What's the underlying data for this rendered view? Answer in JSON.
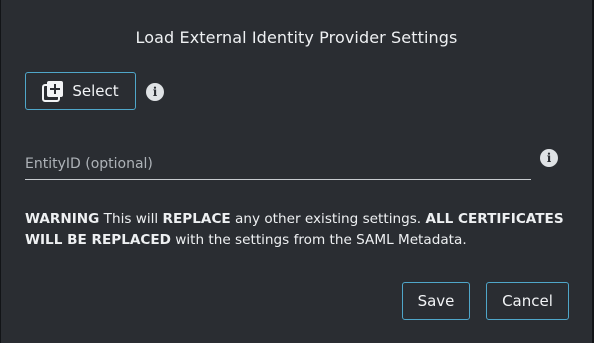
{
  "dialog": {
    "title": "Load External Identity Provider Settings",
    "select_label": "Select",
    "entity_placeholder": "EntityID (optional)",
    "entity_value": "",
    "warning": {
      "part1_bold": "WARNING",
      "part2": " This will ",
      "part3_bold": "REPLACE",
      "part4": " any other existing settings. ",
      "part5_bold": "ALL CERTIFICATES WILL BE REPLACED",
      "part6": " with the settings from the SAML Metadata."
    },
    "save_label": "Save",
    "cancel_label": "Cancel"
  },
  "icons": {
    "select": "library-add-icon",
    "info": "info-icon"
  },
  "colors": {
    "background": "#2a2d32",
    "accent_border": "#4fa6c9",
    "text": "#eef0f2"
  }
}
